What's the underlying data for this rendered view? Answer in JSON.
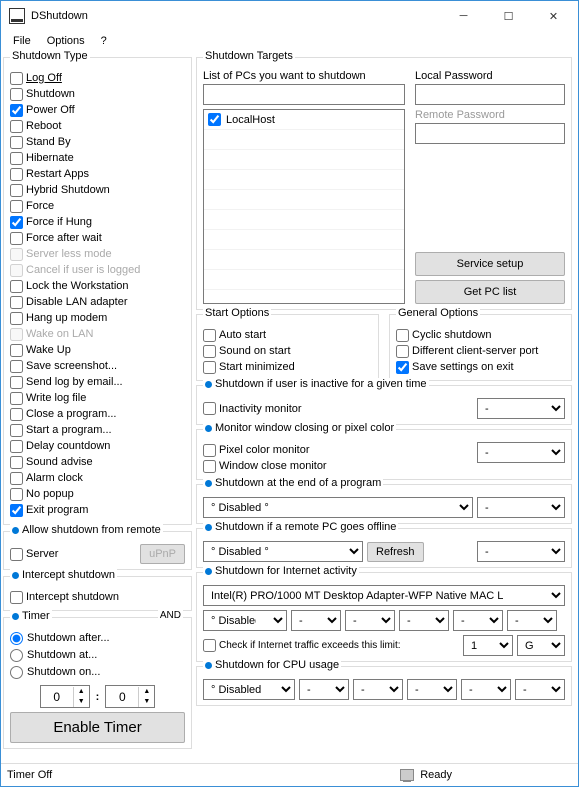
{
  "title": "DShutdown",
  "menu": {
    "file": "File",
    "options": "Options",
    "help": "?"
  },
  "shutdownType": {
    "legend": "Shutdown Type",
    "items": [
      {
        "label": "Log Off",
        "checked": false,
        "underline": true
      },
      {
        "label": "Shutdown",
        "checked": false
      },
      {
        "label": "Power Off",
        "checked": true
      },
      {
        "label": "Reboot",
        "checked": false
      },
      {
        "label": "Stand By",
        "checked": false
      },
      {
        "label": "Hibernate",
        "checked": false
      },
      {
        "label": "Restart Apps",
        "checked": false
      },
      {
        "label": "Hybrid Shutdown",
        "checked": false
      },
      {
        "label": "Force",
        "checked": false
      },
      {
        "label": "Force if Hung",
        "checked": true
      },
      {
        "label": "Force after wait",
        "checked": false
      },
      {
        "label": "Server less mode",
        "checked": false,
        "disabled": true
      },
      {
        "label": "Cancel if user is logged",
        "checked": false,
        "disabled": true
      },
      {
        "label": "Lock the Workstation",
        "checked": false
      },
      {
        "label": "Disable LAN adapter",
        "checked": false
      },
      {
        "label": "Hang up modem",
        "checked": false
      },
      {
        "label": "Wake on LAN",
        "checked": false,
        "disabled": true
      },
      {
        "label": "Wake Up",
        "checked": false
      },
      {
        "label": "Save screenshot...",
        "checked": false
      },
      {
        "label": "Send log by email...",
        "checked": false
      },
      {
        "label": "Write log file",
        "checked": false
      },
      {
        "label": "Close a program...",
        "checked": false
      },
      {
        "label": "Start a program...",
        "checked": false
      },
      {
        "label": "Delay countdown",
        "checked": false
      },
      {
        "label": "Sound advise",
        "checked": false
      },
      {
        "label": "Alarm clock",
        "checked": false
      },
      {
        "label": "No popup",
        "checked": false
      },
      {
        "label": "Exit program",
        "checked": true
      }
    ]
  },
  "allowRemote": {
    "legend": "Allow shutdown from remote",
    "server": "Server",
    "upnp": "uPnP"
  },
  "intercept": {
    "legend": "Intercept shutdown",
    "label": "Intercept shutdown"
  },
  "timer": {
    "legend": "Timer",
    "and": "AND",
    "after": "Shutdown after...",
    "at": "Shutdown at...",
    "on": "Shutdown on...",
    "h": "0",
    "m": "0",
    "enable": "Enable Timer"
  },
  "targets": {
    "legend": "Shutdown Targets",
    "listLabel": "List of PCs you want to shutdown",
    "localPwd": "Local Password",
    "remotePwd": "Remote Password",
    "host": "LocalHost",
    "service": "Service setup",
    "getpc": "Get PC list"
  },
  "startOpt": {
    "legend": "Start Options",
    "auto": "Auto start",
    "sound": "Sound on start",
    "min": "Start minimized"
  },
  "genOpt": {
    "legend": "General Options",
    "cyclic": "Cyclic shutdown",
    "port": "Different client-server port",
    "save": "Save settings on exit"
  },
  "inactive": {
    "legend": "Shutdown if user is inactive for a given time",
    "mon": "Inactivity monitor",
    "dash": "-"
  },
  "pixel": {
    "legend": "Monitor window closing or pixel color",
    "pix": "Pixel color monitor",
    "win": "Window close monitor",
    "dash": "-"
  },
  "endProg": {
    "legend": "Shutdown at the end of a program",
    "disabled": "° Disabled °",
    "dash": "-"
  },
  "offline": {
    "legend": "Shutdown if a remote PC goes offline",
    "disabled": "° Disabled °",
    "refresh": "Refresh",
    "dash": "-"
  },
  "internet": {
    "legend": "Shutdown for Internet activity",
    "adapter": "Intel(R) PRO/1000 MT Desktop Adapter-WFP Native MAC L",
    "disabled": "° Disabled",
    "dash": "-",
    "check": "Check if Internet traffic exceeds this limit:",
    "num": "1",
    "unit": "GB"
  },
  "cpu": {
    "legend": "Shutdown for CPU usage",
    "disabled": "° Disabled °",
    "dash": "-"
  },
  "status": {
    "timer": "Timer Off",
    "ready": "Ready"
  }
}
